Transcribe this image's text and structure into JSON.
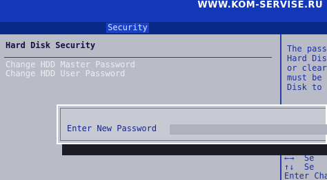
{
  "watermark": "WWW.KOM-SERVISE.RU",
  "tab": {
    "label": "Security"
  },
  "section": {
    "title": "Hard Disk Security"
  },
  "options": [
    {
      "label": "Change HDD Master Password"
    },
    {
      "label": "Change HDD User Password"
    }
  ],
  "help": {
    "text": "The pass\nHard Dis\nor clear\nmust be\nDisk to",
    "keys": "←→  Se\n↑↓  Se\nEnter Cha"
  },
  "dialog": {
    "label": "Enter New Password",
    "value": ""
  },
  "colors": {
    "background": "#0a2a8a",
    "panel": "#b9bcc6",
    "dialog": "#c7cad3",
    "text_dark": "#15258a",
    "option_text": "#ecedf3"
  }
}
